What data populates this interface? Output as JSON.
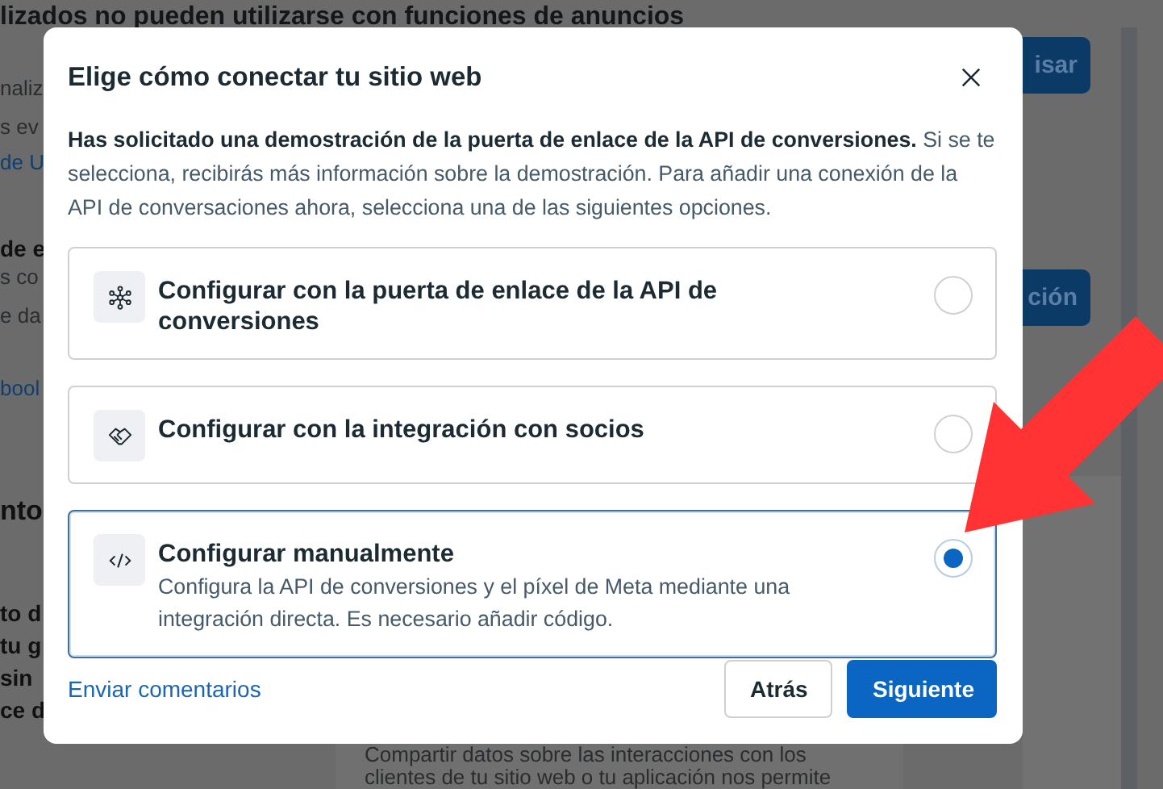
{
  "background": {
    "heading": "lizados no pueden utilizarse con funciones de anuncios",
    "left_fragments": [
      {
        "text": "naliz",
        "kind": "muted"
      },
      {
        "text": "s ev",
        "kind": "muted"
      },
      {
        "text": "de U",
        "kind": "link"
      },
      {
        "text": "de e",
        "kind": "bold"
      },
      {
        "text": "s co",
        "kind": "muted"
      },
      {
        "text": "e da",
        "kind": "muted"
      },
      {
        "text": "bool",
        "kind": "link"
      },
      {
        "text": "nto",
        "kind": "heading"
      },
      {
        "text": "to d",
        "kind": "bold"
      },
      {
        "text": "tu g",
        "kind": "bold"
      },
      {
        "text": "sin",
        "kind": "bold"
      },
      {
        "text": "ce d",
        "kind": "bold"
      }
    ],
    "right_buttons": [
      "isar",
      "ción"
    ],
    "bottom_text": "Compartir datos sobre las interacciones con los clientes de tu sitio web o tu aplicación nos permite"
  },
  "dialog": {
    "title": "Elige cómo conectar tu sitio web",
    "intro": "**Has solicitado una demostración de la puerta de enlace de la API de conversiones.** Si se te selecciona, recibirás más información sobre la demostración. Para añadir una conexión de la API de conversaciones ahora, selecciona una de las siguientes opciones.",
    "options": [
      {
        "kind": "gateway",
        "title": "Configurar con la puerta de enlace de la API de conversiones",
        "selected": false
      },
      {
        "kind": "partner",
        "title": "Configurar con la integración con socios",
        "selected": false
      },
      {
        "kind": "code",
        "title": "Configurar manualmente",
        "description": "Configura la API de conversiones y el píxel de Meta mediante una integración directa. Es necesario añadir código.",
        "selected": true
      }
    ],
    "feedback_link": "Enviar comentarios",
    "buttons": [
      {
        "label": "Atrás",
        "kind": "secondary"
      },
      {
        "label": "Siguiente",
        "kind": "primary"
      }
    ]
  }
}
